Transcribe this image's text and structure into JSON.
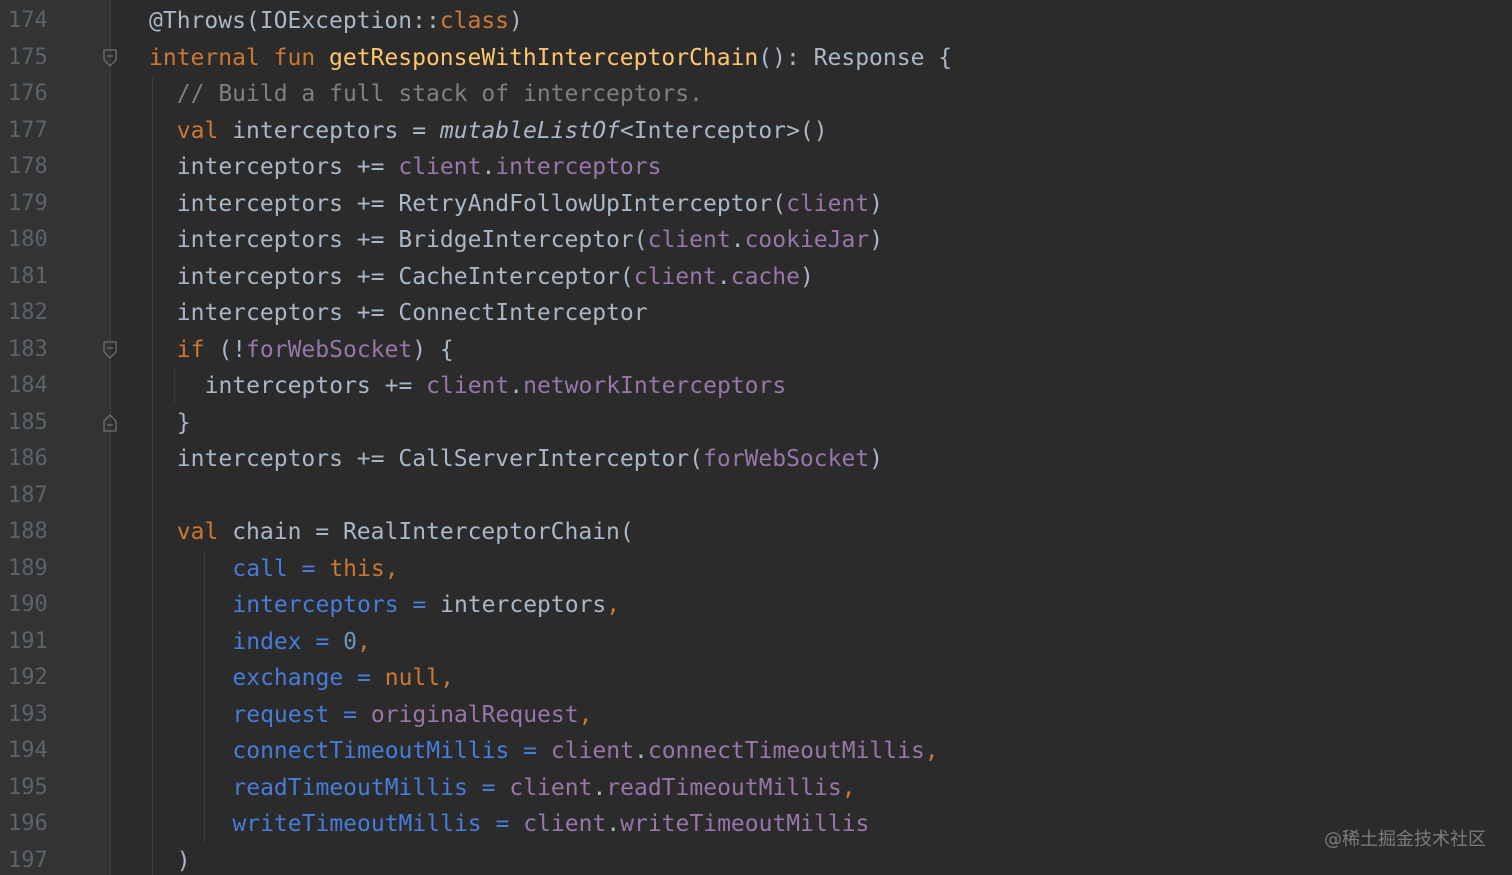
{
  "editor": {
    "colors": {
      "background": "#2b2b2b",
      "gutter": "#313335",
      "line_number": "#606366",
      "keyword": "#cc7832",
      "function": "#ffc66d",
      "comment": "#808080",
      "property": "#9876aa",
      "number": "#6897bb",
      "named_arg": "#467cda",
      "default": "#a9b7c6"
    },
    "lines": [
      {
        "n": "174",
        "fold": null,
        "indent": 0,
        "tokens": [
          {
            "t": "@Throws(IOException::",
            "c": "t-ann2"
          },
          {
            "t": "class",
            "c": "t-kw"
          },
          {
            "t": ")",
            "c": "t-def"
          }
        ]
      },
      {
        "n": "175",
        "fold": "open",
        "indent": 0,
        "tokens": [
          {
            "t": "internal fun ",
            "c": "t-kw"
          },
          {
            "t": "getResponseWithInterceptorChain",
            "c": "t-fn"
          },
          {
            "t": "(): Response {",
            "c": "t-def"
          }
        ]
      },
      {
        "n": "176",
        "fold": null,
        "indent": 1,
        "tokens": [
          {
            "t": "// Build a full stack of interceptors.",
            "c": "t-cm"
          }
        ]
      },
      {
        "n": "177",
        "fold": null,
        "indent": 1,
        "tokens": [
          {
            "t": "val ",
            "c": "t-kw"
          },
          {
            "t": "interceptors = ",
            "c": "t-def"
          },
          {
            "t": "mutableListOf",
            "c": "t-it"
          },
          {
            "t": "<Interceptor>()",
            "c": "t-def"
          }
        ]
      },
      {
        "n": "178",
        "fold": null,
        "indent": 1,
        "tokens": [
          {
            "t": "interceptors += ",
            "c": "t-def"
          },
          {
            "t": "client",
            "c": "t-prop"
          },
          {
            "t": ".",
            "c": "t-def"
          },
          {
            "t": "interceptors",
            "c": "t-prop"
          }
        ]
      },
      {
        "n": "179",
        "fold": null,
        "indent": 1,
        "tokens": [
          {
            "t": "interceptors += RetryAndFollowUpInterceptor(",
            "c": "t-def"
          },
          {
            "t": "client",
            "c": "t-prop"
          },
          {
            "t": ")",
            "c": "t-def"
          }
        ]
      },
      {
        "n": "180",
        "fold": null,
        "indent": 1,
        "tokens": [
          {
            "t": "interceptors += BridgeInterceptor(",
            "c": "t-def"
          },
          {
            "t": "client",
            "c": "t-prop"
          },
          {
            "t": ".",
            "c": "t-def"
          },
          {
            "t": "cookieJar",
            "c": "t-prop"
          },
          {
            "t": ")",
            "c": "t-def"
          }
        ]
      },
      {
        "n": "181",
        "fold": null,
        "indent": 1,
        "tokens": [
          {
            "t": "interceptors += CacheInterceptor(",
            "c": "t-def"
          },
          {
            "t": "client",
            "c": "t-prop"
          },
          {
            "t": ".",
            "c": "t-def"
          },
          {
            "t": "cache",
            "c": "t-prop"
          },
          {
            "t": ")",
            "c": "t-def"
          }
        ]
      },
      {
        "n": "182",
        "fold": null,
        "indent": 1,
        "tokens": [
          {
            "t": "interceptors += ConnectInterceptor",
            "c": "t-def"
          }
        ]
      },
      {
        "n": "183",
        "fold": "open",
        "indent": 1,
        "tokens": [
          {
            "t": "if ",
            "c": "t-kw"
          },
          {
            "t": "(!",
            "c": "t-def"
          },
          {
            "t": "forWebSocket",
            "c": "t-prop"
          },
          {
            "t": ") {",
            "c": "t-def"
          }
        ]
      },
      {
        "n": "184",
        "fold": null,
        "indent": 2,
        "tokens": [
          {
            "t": "interceptors += ",
            "c": "t-def"
          },
          {
            "t": "client",
            "c": "t-prop"
          },
          {
            "t": ".",
            "c": "t-def"
          },
          {
            "t": "networkInterceptors",
            "c": "t-prop"
          }
        ]
      },
      {
        "n": "185",
        "fold": "close",
        "indent": 1,
        "tokens": [
          {
            "t": "}",
            "c": "t-def"
          }
        ]
      },
      {
        "n": "186",
        "fold": null,
        "indent": 1,
        "tokens": [
          {
            "t": "interceptors += CallServerInterceptor(",
            "c": "t-def"
          },
          {
            "t": "forWebSocket",
            "c": "t-prop"
          },
          {
            "t": ")",
            "c": "t-def"
          }
        ]
      },
      {
        "n": "187",
        "fold": null,
        "indent": 1,
        "tokens": []
      },
      {
        "n": "188",
        "fold": null,
        "indent": 1,
        "tokens": [
          {
            "t": "val ",
            "c": "t-kw"
          },
          {
            "t": "chain = RealInterceptorChain(",
            "c": "t-def"
          }
        ]
      },
      {
        "n": "189",
        "fold": null,
        "indent": 3,
        "tokens": [
          {
            "t": "call = ",
            "c": "t-named"
          },
          {
            "t": "this,",
            "c": "t-kw"
          }
        ]
      },
      {
        "n": "190",
        "fold": null,
        "indent": 3,
        "tokens": [
          {
            "t": "interceptors = ",
            "c": "t-named"
          },
          {
            "t": "interceptors",
            "c": "t-def"
          },
          {
            "t": ",",
            "c": "t-kw"
          }
        ]
      },
      {
        "n": "191",
        "fold": null,
        "indent": 3,
        "tokens": [
          {
            "t": "index = ",
            "c": "t-named"
          },
          {
            "t": "0",
            "c": "t-num"
          },
          {
            "t": ",",
            "c": "t-kw"
          }
        ]
      },
      {
        "n": "192",
        "fold": null,
        "indent": 3,
        "tokens": [
          {
            "t": "exchange = ",
            "c": "t-named"
          },
          {
            "t": "null,",
            "c": "t-kw"
          }
        ]
      },
      {
        "n": "193",
        "fold": null,
        "indent": 3,
        "tokens": [
          {
            "t": "request = ",
            "c": "t-named"
          },
          {
            "t": "originalRequest",
            "c": "t-prop"
          },
          {
            "t": ",",
            "c": "t-kw"
          }
        ]
      },
      {
        "n": "194",
        "fold": null,
        "indent": 3,
        "tokens": [
          {
            "t": "connectTimeoutMillis = ",
            "c": "t-named"
          },
          {
            "t": "client",
            "c": "t-prop"
          },
          {
            "t": ".",
            "c": "t-def"
          },
          {
            "t": "connectTimeoutMillis",
            "c": "t-prop"
          },
          {
            "t": ",",
            "c": "t-kw"
          }
        ]
      },
      {
        "n": "195",
        "fold": null,
        "indent": 3,
        "tokens": [
          {
            "t": "readTimeoutMillis = ",
            "c": "t-named"
          },
          {
            "t": "client",
            "c": "t-prop"
          },
          {
            "t": ".",
            "c": "t-def"
          },
          {
            "t": "readTimeoutMillis",
            "c": "t-prop"
          },
          {
            "t": ",",
            "c": "t-kw"
          }
        ]
      },
      {
        "n": "196",
        "fold": null,
        "indent": 3,
        "tokens": [
          {
            "t": "writeTimeoutMillis = ",
            "c": "t-named"
          },
          {
            "t": "client",
            "c": "t-prop"
          },
          {
            "t": ".",
            "c": "t-def"
          },
          {
            "t": "writeTimeoutMillis",
            "c": "t-prop"
          }
        ]
      },
      {
        "n": "197",
        "fold": null,
        "indent": 1,
        "tokens": [
          {
            "t": ")",
            "c": "t-def"
          }
        ]
      }
    ]
  },
  "watermark": "@稀土掘金技术社区"
}
